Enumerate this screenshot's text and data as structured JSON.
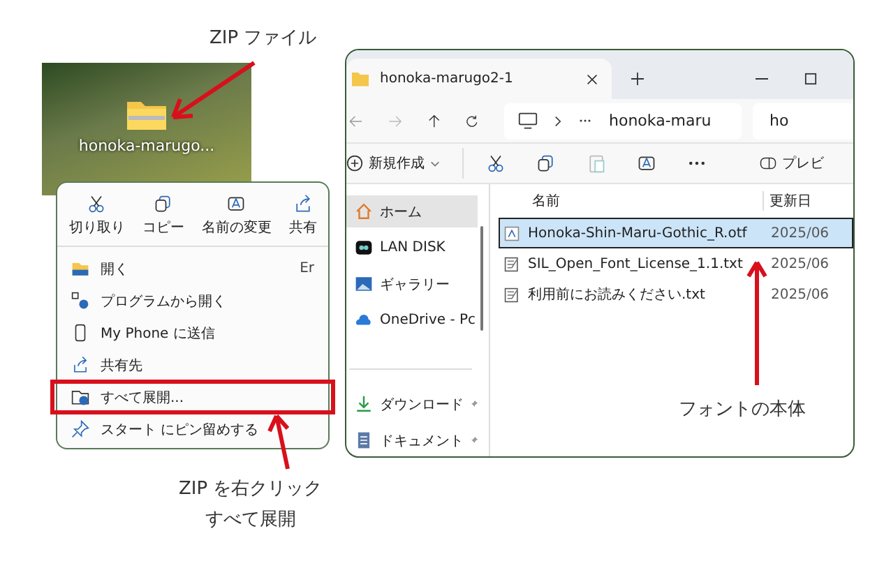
{
  "desktop": {
    "file_name": "honoka-marugo..."
  },
  "context_menu": {
    "actions": [
      {
        "label": "切り取り"
      },
      {
        "label": "コピー"
      },
      {
        "label": "名前の変更"
      },
      {
        "label": "共有"
      }
    ],
    "items": [
      {
        "label": "開く",
        "shortcut": "Er",
        "highlighted": false
      },
      {
        "label": "プログラムから開く",
        "highlighted": false
      },
      {
        "label": "My Phone に送信",
        "highlighted": false
      },
      {
        "label": "共有先",
        "highlighted": false
      },
      {
        "label": "すべて展開...",
        "highlighted": true
      },
      {
        "label": "スタート にピン留めする",
        "highlighted": false
      }
    ]
  },
  "explorer": {
    "tab_title": "honoka-marugo2-1",
    "address": "honoka-maru",
    "search": "ho",
    "toolbar": {
      "new_label": "新規作成",
      "preview_label": "プレビ"
    },
    "sidebar": {
      "items": [
        {
          "label": "ホーム",
          "selected": true,
          "pinned": false
        },
        {
          "label": "LAN DISK",
          "selected": false,
          "pinned": false
        },
        {
          "label": "ギャラリー",
          "selected": false,
          "pinned": false
        },
        {
          "label": "OneDrive - Pc",
          "selected": false,
          "pinned": false
        }
      ],
      "quick_access": [
        {
          "label": "ダウンロード",
          "selected": false,
          "pinned": true
        },
        {
          "label": "ドキュメント",
          "selected": false,
          "pinned": true
        }
      ]
    },
    "columns": [
      "名前",
      "更新日"
    ],
    "files": [
      {
        "kind": "font",
        "name": "Honoka-Shin-Maru-Gothic_R.otf",
        "date": "2025/06",
        "selected": true
      },
      {
        "kind": "text",
        "name": "SIL_Open_Font_License_1.1.txt",
        "date": "2025/06",
        "selected": false
      },
      {
        "kind": "text",
        "name": "利用前にお読みください.txt",
        "date": "2025/06",
        "selected": false
      }
    ]
  },
  "annotations": {
    "zip_file": "ZIP ファイル",
    "font_body": "フォントの本体",
    "right_click": [
      "ZIP を右クリック",
      "すべて展開"
    ]
  }
}
